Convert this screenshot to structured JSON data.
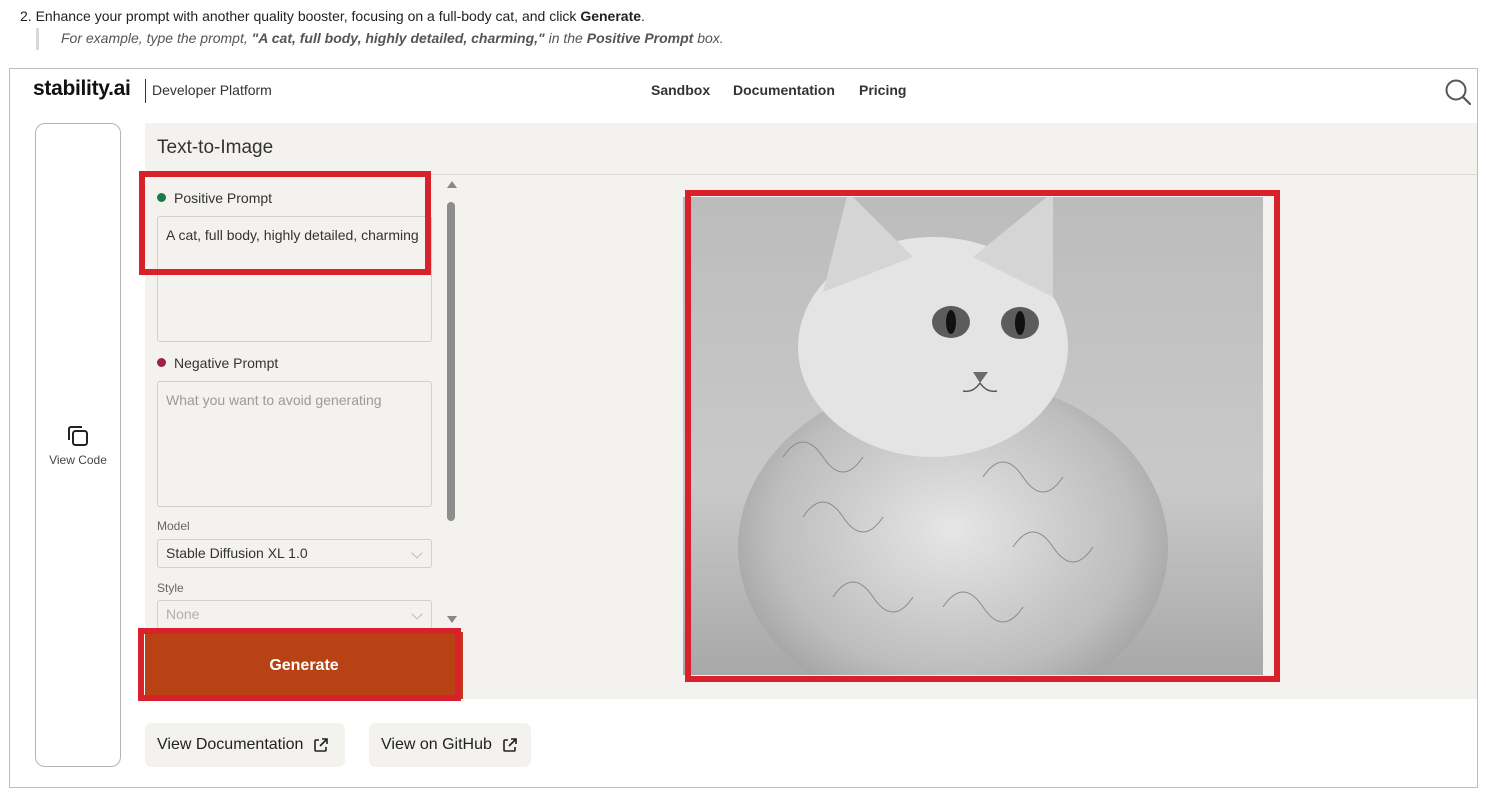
{
  "instruction": {
    "step_text_before": "2. Enhance your prompt with another quality booster, focusing on a full-body cat, and click ",
    "step_bold": "Generate",
    "step_text_after": ".",
    "example_before": "For example, type the prompt, ",
    "example_prompt": "\"A cat, full body, highly detailed, charming,\"",
    "example_middle": " in the ",
    "example_field": "Positive Prompt",
    "example_after": " box."
  },
  "header": {
    "logo": "stability.ai",
    "platform": "Developer Platform",
    "nav": [
      "Sandbox",
      "Documentation",
      "Pricing"
    ],
    "search_icon": "search-icon"
  },
  "sidebar": {
    "view_code_label": "View Code",
    "icon": "copy-icon"
  },
  "panel": {
    "title": "Text-to-Image",
    "positive_label": "Positive Prompt",
    "positive_value": "A cat, full body, highly detailed, charming",
    "negative_label": "Negative Prompt",
    "negative_placeholder": "What you want to avoid generating",
    "model_label": "Model",
    "model_value": "Stable Diffusion XL 1.0",
    "style_label": "Style",
    "style_value": "None",
    "generate_label": "Generate"
  },
  "links": {
    "docs": "View Documentation",
    "github": "View on GitHub"
  },
  "colors": {
    "accent": "#b94214",
    "highlight": "#d9212b",
    "positive_dot": "#1a7a4a",
    "negative_dot": "#9c2147",
    "panel_bg": "#f4f2ee"
  }
}
